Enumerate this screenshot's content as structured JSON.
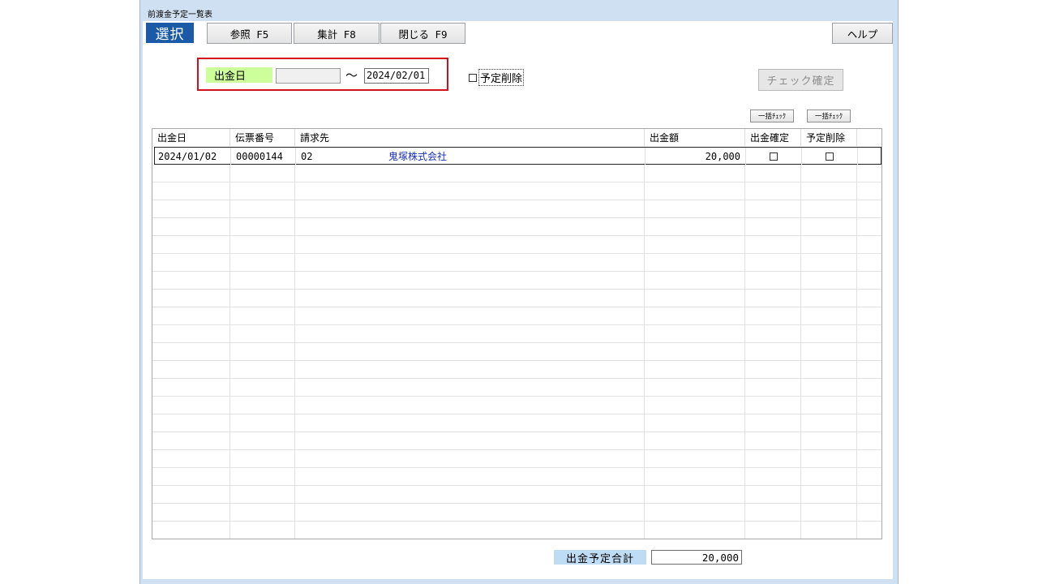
{
  "window": {
    "title": "前渡金予定一覧表"
  },
  "toolbar": {
    "select_label": "選択",
    "reference_label": "参照 F5",
    "aggregate_label": "集計 F8",
    "close_label": "閉じる F9",
    "help_label": "ヘルプ"
  },
  "filter": {
    "date_label": "出金日",
    "date_from": "",
    "range_sep": "～",
    "date_to": "2024/02/01",
    "delete_checkbox_label": "予定削除",
    "delete_checked": false
  },
  "actions": {
    "confirm_check_label": "チェック確定",
    "bulk_check_1": "一括ﾁｪｯｸ",
    "bulk_check_2": "一括ﾁｪｯｸ"
  },
  "table": {
    "columns": [
      "出金日",
      "伝票番号",
      "請求先",
      "出金額",
      "出金確定",
      "予定削除"
    ],
    "rows": [
      {
        "date": "2024/01/02",
        "voucher": "00000144",
        "code": "02",
        "name": "鬼塚株式会社",
        "amount": "20,000",
        "confirmed": false,
        "delete": false
      }
    ]
  },
  "footer": {
    "total_label": "出金予定合計",
    "total_value": "20,000"
  },
  "colors": {
    "select_button_bg": "#1b5aa6",
    "date_label_bg": "#ccff99",
    "total_label_bg": "#bfdcf5",
    "highlight_box": "#d0111b",
    "customer_name": "#1a2fb5"
  }
}
